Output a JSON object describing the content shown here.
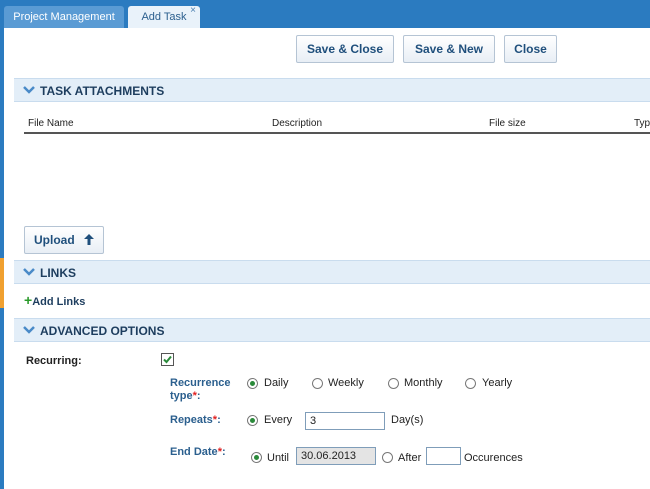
{
  "tabs": [
    {
      "label": "Project Management",
      "active": false
    },
    {
      "label": "Add Task",
      "active": true,
      "close": "×"
    }
  ],
  "toolbar": {
    "save_close": "Save & Close",
    "save_new": "Save & New",
    "close": "Close"
  },
  "attachments": {
    "title": "TASK ATTACHMENTS",
    "columns": [
      "File Name",
      "Description",
      "File size",
      "Typ"
    ],
    "upload_label": "Upload"
  },
  "links": {
    "title": "LINKS",
    "add_label": "Add Links"
  },
  "advanced": {
    "title": "ADVANCED OPTIONS",
    "recurring_label": "Recurring:",
    "recurring_checked": true,
    "recurrence_label_1": "Recurrence",
    "recurrence_label_2": "type",
    "recurrence_options": [
      "Daily",
      "Weekly",
      "Monthly",
      "Yearly"
    ],
    "recurrence_selected": "Daily",
    "repeats_label": "Repeats",
    "repeats_every": "Every",
    "repeats_value": "3",
    "repeats_unit": "Day(s)",
    "end_label": "End Date",
    "until_label": "Until",
    "until_value": "30.06.2013",
    "after_label": "After",
    "after_value": "",
    "occurrences_label": "Occurences",
    "required_mark": "*",
    "colon": ":"
  },
  "colors": {
    "tabbar": "#2b7bc0",
    "section_bg": "#e3eef8",
    "accent_text": "#2b5f8e",
    "required": "#e02020"
  }
}
